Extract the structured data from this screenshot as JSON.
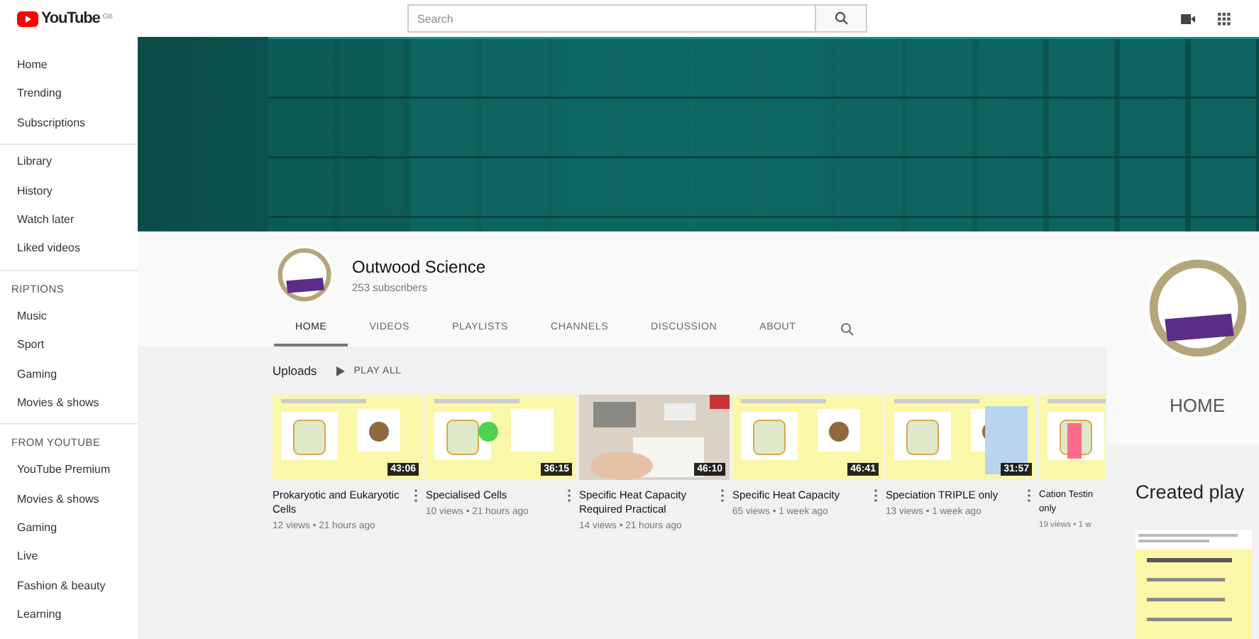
{
  "header": {
    "logo_text": "YouTube",
    "region": "GB",
    "search": {
      "placeholder": "Search"
    }
  },
  "sidebar": [
    {
      "items": [
        "Home",
        "Trending",
        "Subscriptions"
      ]
    },
    {
      "items": [
        "Library",
        "History",
        "Watch later",
        "Liked videos"
      ]
    },
    {
      "heading": "RIPTIONS",
      "items": [
        "Music",
        "Sport",
        "Gaming",
        "Movies & shows"
      ]
    },
    {
      "heading": "FROM YOUTUBE",
      "items": [
        "YouTube Premium",
        "Movies & shows",
        "Gaming",
        "Live",
        "Fashion & beauty",
        "Learning"
      ]
    }
  ],
  "channel": {
    "name": "Outwood Science",
    "subscribers": "253 subscribers",
    "tabs": [
      {
        "label": "HOME",
        "selected": true
      },
      {
        "label": "VIDEOS",
        "selected": false
      },
      {
        "label": "PLAYLISTS",
        "selected": false
      },
      {
        "label": "CHANNELS",
        "selected": false
      },
      {
        "label": "DISCUSSION",
        "selected": false
      },
      {
        "label": "ABOUT",
        "selected": false
      }
    ]
  },
  "shelf": {
    "title": "Uploads",
    "play_all": "PLAY ALL",
    "videos": [
      {
        "kind": "full",
        "title": "Prokaryotic and Eukaryotic Cells",
        "meta": "12 views • 21 hours ago",
        "duration": "43:06"
      },
      {
        "kind": "full",
        "title": "Specialised Cells",
        "meta": "10 views • 21 hours ago",
        "duration": "36:15"
      },
      {
        "kind": "full",
        "title": "Specific Heat Capacity Required Practical",
        "meta": "14 views • 21 hours ago",
        "duration": "46:10"
      },
      {
        "kind": "full",
        "title": "Specific Heat Capacity",
        "meta": "65 views • 1 week ago",
        "duration": "46:41"
      },
      {
        "kind": "full",
        "title": "Speciation TRIPLE only",
        "meta": "13 views • 1 week ago",
        "duration": "31:57"
      },
      {
        "kind": "partial",
        "title": "Cation Testin only",
        "meta": "19 views • 1 w"
      }
    ]
  },
  "overlay": {
    "tab": "HOME",
    "heading": "Created play"
  }
}
